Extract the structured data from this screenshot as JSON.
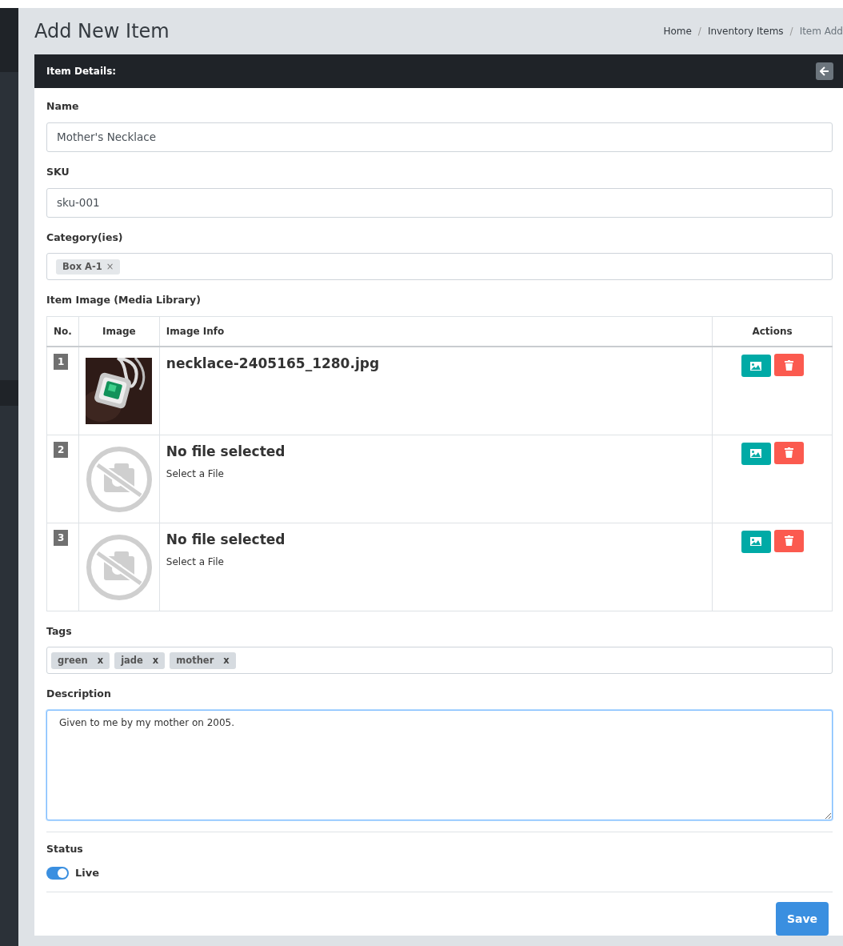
{
  "page_title": "Add New Item",
  "breadcrumb_separator": "/",
  "breadcrumb": [
    {
      "label": "Home"
    },
    {
      "label": "Inventory Items"
    },
    {
      "label": "Item Add"
    }
  ],
  "card": {
    "title": "Item Details:"
  },
  "name": {
    "label": "Name",
    "value": "Mother's Necklace"
  },
  "sku": {
    "label": "SKU",
    "value": "sku-001"
  },
  "categories": {
    "label": "Category(ies)",
    "chips": [
      {
        "label": "Box A-1",
        "remove": "×"
      }
    ]
  },
  "images": {
    "label": "Item Image (Media Library)",
    "columns": [
      "No.",
      "Image",
      "Image Info",
      "Actions"
    ],
    "rows": [
      {
        "number": "1",
        "kind": "picture",
        "title": "necklace-2405165_1280.jpg"
      },
      {
        "number": "2",
        "kind": "empty",
        "title": "No file selected",
        "hint": "Select a File"
      },
      {
        "number": "3",
        "kind": "empty",
        "title": "No file selected",
        "hint": "Select a File"
      }
    ]
  },
  "tags": {
    "label": "Tags",
    "chips": [
      {
        "label": "green",
        "remove": "x"
      },
      {
        "label": "jade",
        "remove": "x"
      },
      {
        "label": "mother",
        "remove": "x"
      }
    ]
  },
  "description": {
    "label": "Description",
    "value": "Given to me by my mother on 2005.",
    "focused": true
  },
  "status": {
    "label": "Status",
    "on": true,
    "text": "Live"
  },
  "save": "Save"
}
